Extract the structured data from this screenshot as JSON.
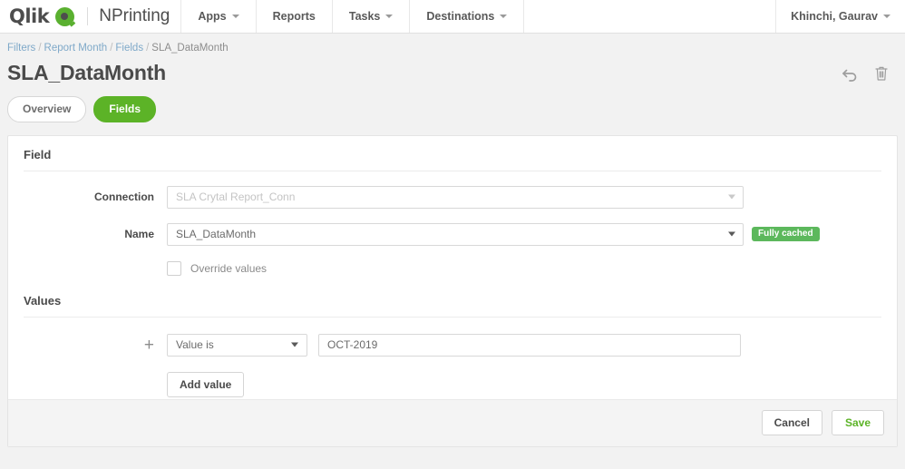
{
  "topbar": {
    "brand": "Qlik",
    "brand_mark_icon": "qlik-logo-icon",
    "product": "NPrinting",
    "nav": [
      {
        "label": "Apps",
        "has_caret": true
      },
      {
        "label": "Reports",
        "has_caret": false
      },
      {
        "label": "Tasks",
        "has_caret": true
      },
      {
        "label": "Destinations",
        "has_caret": true
      }
    ],
    "user": "Khinchi, Gaurav"
  },
  "breadcrumb": {
    "items": [
      "Filters",
      "Report Month",
      "Fields"
    ],
    "current": "SLA_DataMonth",
    "separator": "/"
  },
  "page": {
    "title": "SLA_DataMonth",
    "actions": [
      {
        "icon": "undo-arrow-icon"
      },
      {
        "icon": "trash-icon"
      }
    ]
  },
  "tabs": [
    {
      "label": "Overview",
      "active": false
    },
    {
      "label": "Fields",
      "active": true
    }
  ],
  "field_section": {
    "heading": "Field",
    "connection": {
      "label": "Connection",
      "value": "SLA Crytal Report_Conn",
      "is_placeholder": true
    },
    "name": {
      "label": "Name",
      "value": "SLA_DataMonth",
      "badge": "Fully cached"
    },
    "override": {
      "label": "Override values",
      "checked": false
    }
  },
  "values_section": {
    "heading": "Values",
    "rows": [
      {
        "add_icon": "plus-icon",
        "operator": "Value is",
        "value": "OCT-2019"
      }
    ],
    "add_value_label": "Add value"
  },
  "footer": {
    "cancel_label": "Cancel",
    "save_label": "Save"
  },
  "colors": {
    "accent_green": "#5cb327",
    "badge_green": "#5cb85c",
    "page_bg": "#f2f2f2",
    "link_blue": "#7fa9c9"
  }
}
